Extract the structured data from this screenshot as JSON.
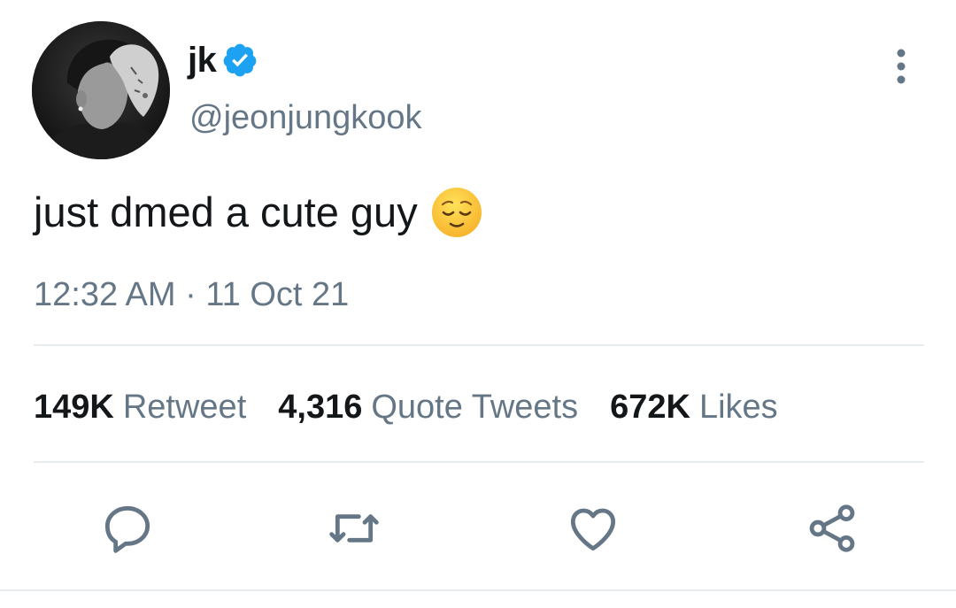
{
  "author": {
    "display_name": "jk",
    "handle": "@jeonjungkook",
    "verified": true
  },
  "tweet": {
    "text": "just dmed a cute guy",
    "emoji": "relieved-face-emoji",
    "time": "12:32 AM",
    "separator": "·",
    "date": "11 Oct 21"
  },
  "stats": [
    {
      "count": "149K",
      "label": "Retweet"
    },
    {
      "count": "4,316",
      "label": "Quote Tweets"
    },
    {
      "count": "672K",
      "label": "Likes"
    }
  ],
  "actions": [
    {
      "icon": "reply-icon"
    },
    {
      "icon": "retweet-icon"
    },
    {
      "icon": "like-icon"
    },
    {
      "icon": "share-icon"
    }
  ],
  "colors": {
    "text_primary": "#14171a",
    "text_secondary": "#657786",
    "verified_blue": "#1da1f2",
    "divider": "#e6ecf0",
    "icon": "#657786"
  }
}
